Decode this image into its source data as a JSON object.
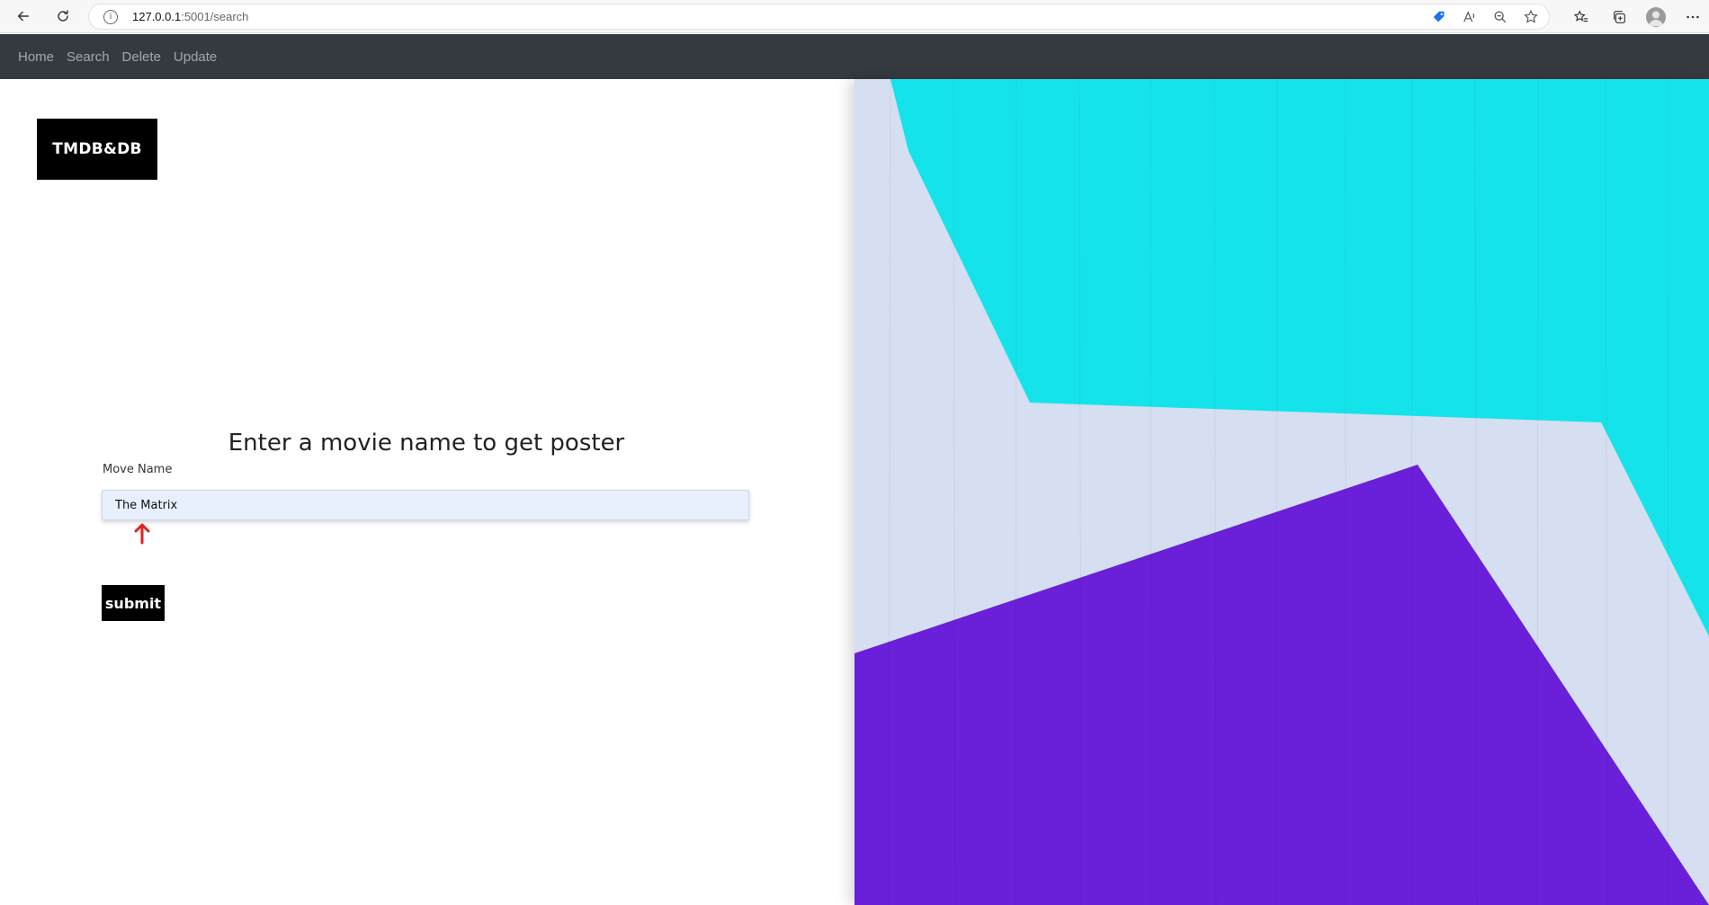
{
  "browser": {
    "url_host": "127.0.0.1",
    "url_path": ":5001/search"
  },
  "navbar": {
    "items": [
      {
        "label": "Home"
      },
      {
        "label": "Search"
      },
      {
        "label": "Delete"
      },
      {
        "label": "Update"
      }
    ]
  },
  "logo": {
    "text": "TMDB&DB"
  },
  "main": {
    "heading": "Enter a movie name to get poster",
    "field_label": "Move Name",
    "input_value": "The Matrix",
    "submit_label": "submit"
  },
  "colors": {
    "navbar_bg": "#343a40",
    "input_bg": "#e8f0fe",
    "art_cyan": "#14e3ea",
    "art_purple": "#6a1fd8",
    "art_lavender": "#d6def2",
    "annotation_arrow": "#e02020"
  }
}
